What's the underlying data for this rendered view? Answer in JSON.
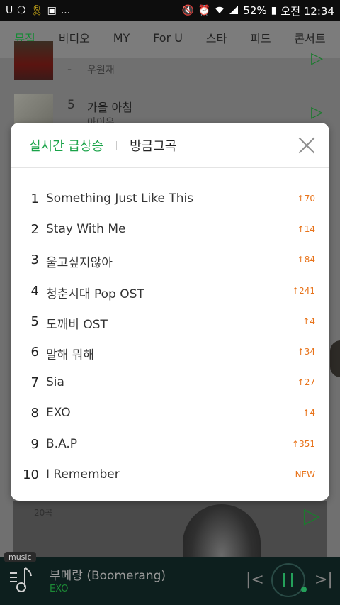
{
  "statusbar": {
    "left_icons": [
      "U",
      "❍",
      "🎗",
      "▣",
      "..."
    ],
    "right_icons": [
      "🔇",
      "⏰",
      "wifi",
      "signal"
    ],
    "battery": "52%",
    "time": "오전 12:34"
  },
  "nav": {
    "tabs": [
      "뮤직",
      "비디오",
      "MY",
      "For U",
      "스타",
      "피드",
      "콘서트"
    ],
    "active": 0
  },
  "background_list": [
    {
      "rank": "-",
      "title": "",
      "artist": "우원재"
    },
    {
      "rank": "5",
      "title": "가을 아침",
      "artist": "아이유"
    }
  ],
  "card": {
    "count": "20곡"
  },
  "player": {
    "badge": "music",
    "title": "부메랑 (Boomerang)",
    "artist": "EXO"
  },
  "modal": {
    "tab_live": "실시간 급상승",
    "tab_now": "방금그곡",
    "items": [
      {
        "rank": "1",
        "title": "Something Just Like This",
        "change": "↑70"
      },
      {
        "rank": "2",
        "title": "Stay With Me",
        "change": "↑14"
      },
      {
        "rank": "3",
        "title": "울고싶지않아",
        "change": "↑84"
      },
      {
        "rank": "4",
        "title": "청춘시대 Pop OST",
        "change": "↑241"
      },
      {
        "rank": "5",
        "title": "도깨비 OST",
        "change": "↑4"
      },
      {
        "rank": "6",
        "title": "말해 뭐해",
        "change": "↑34"
      },
      {
        "rank": "7",
        "title": "Sia",
        "change": "↑27"
      },
      {
        "rank": "8",
        "title": "EXO",
        "change": "↑4"
      },
      {
        "rank": "9",
        "title": "B.A.P",
        "change": "↑351"
      },
      {
        "rank": "10",
        "title": "I Remember",
        "change": "NEW"
      }
    ]
  },
  "colors": {
    "accent_green": "#1aa349",
    "change_orange": "#e8731a",
    "player_bg": "#0d1f1e"
  }
}
